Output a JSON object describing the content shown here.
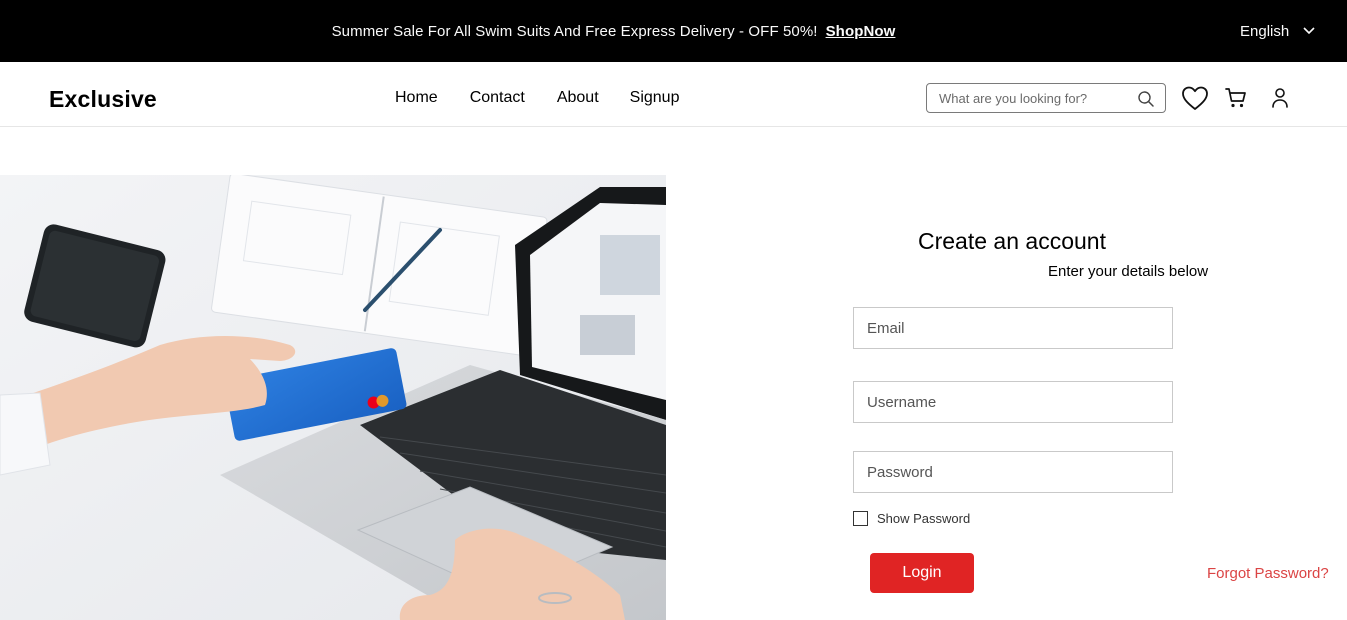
{
  "topbar": {
    "message": "Summer Sale For All Swim Suits And Free Express Delivery - OFF 50%!",
    "shop_link": "ShopNow",
    "language": "English"
  },
  "header": {
    "logo": "Exclusive",
    "nav": [
      "Home",
      "Contact",
      "About",
      "Signup"
    ],
    "search_placeholder": "What are you looking for?",
    "icons": [
      "heart-icon",
      "cart-icon",
      "user-icon"
    ]
  },
  "form": {
    "title": "Create an account",
    "subtitle": "Enter your details below",
    "email_placeholder": "Email",
    "username_placeholder": "Username",
    "password_placeholder": "Password",
    "show_password_label": "Show Password",
    "show_password_checked": false,
    "login_label": "Login",
    "forgot_label": "Forgot Password?"
  },
  "colors": {
    "topbar_bg": "#000000",
    "accent": "#e02424",
    "link_red": "#db4444"
  }
}
